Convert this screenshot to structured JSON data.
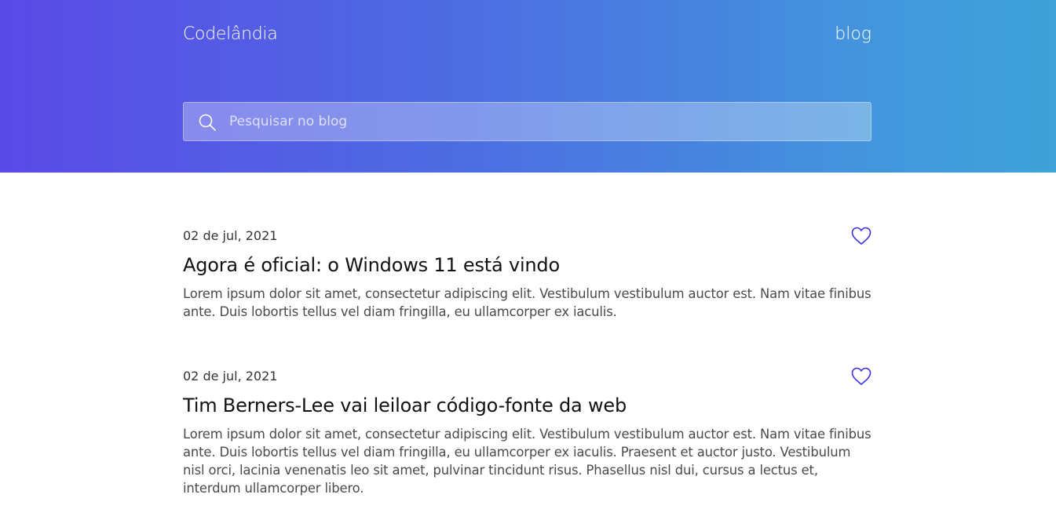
{
  "header": {
    "brand": "Codelândia",
    "nav_link": "blog",
    "search": {
      "placeholder": "Pesquisar no blog",
      "value": ""
    },
    "gradient_colors": [
      "#5a4ae6",
      "#3ea3d9"
    ]
  },
  "posts": [
    {
      "date": "02 de jul, 2021",
      "title": "Agora é oficial: o Windows 11 está vindo",
      "excerpt": "Lorem ipsum dolor sit amet, consectetur adipiscing elit. Vestibulum vestibulum auctor est. Nam vitae finibus ante. Duis lobortis tellus vel diam fringilla, eu ullamcorper ex iaculis.",
      "liked": false
    },
    {
      "date": "02 de jul, 2021",
      "title": "Tim Berners-Lee vai leiloar código-fonte da web",
      "excerpt": "Lorem ipsum dolor sit amet, consectetur adipiscing elit. Vestibulum vestibulum auctor est. Nam vitae finibus ante. Duis lobortis tellus vel diam fringilla, eu ullamcorper ex iaculis. Praesent et auctor justo. Vestibulum nisl orci, lacinia venenatis leo sit amet, pulvinar tincidunt risus. Phasellus nisl dui, cursus a lectus et, interdum ullamcorper libero.",
      "liked": false
    }
  ],
  "colors": {
    "heart": "#3a2ee8",
    "title": "#111111",
    "body_text": "#4a4a4a"
  },
  "icons": {
    "search": "search-icon",
    "like": "heart-icon"
  }
}
